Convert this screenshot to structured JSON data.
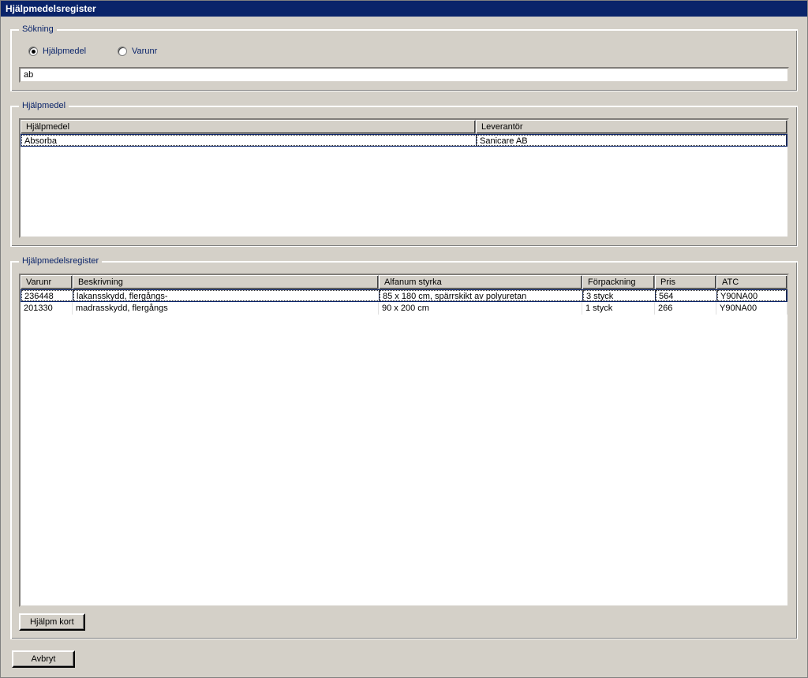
{
  "window": {
    "title": "Hjälpmedelsregister"
  },
  "search": {
    "legend": "Sökning",
    "radio_hjalpmedel": "Hjälpmedel",
    "radio_varunr": "Varunr",
    "input_value": "ab"
  },
  "hlist": {
    "legend": "Hjälpmedel",
    "headers": {
      "col1": "Hjälpmedel",
      "col2": "Leverantör"
    },
    "rows": [
      {
        "col1": "Absorba",
        "col2": "Sanicare AB"
      }
    ]
  },
  "register": {
    "legend": "Hjälpmedelsregister",
    "headers": {
      "col1": "Varunr",
      "col2": "Beskrivning",
      "col3": "Alfanum styrka",
      "col4": "Förpackning",
      "col5": "Pris",
      "col6": "ATC"
    },
    "rows": [
      {
        "col1": "236448",
        "col2": "lakansskydd, flergångs-",
        "col3": "85 x 180 cm, spärrskikt av polyuretan",
        "col4": "3 styck",
        "col5": "564",
        "col6": "Y90NA00"
      },
      {
        "col1": "201330",
        "col2": "madrasskydd, flergångs",
        "col3": "90 x 200 cm",
        "col4": "1 styck",
        "col5": "266",
        "col6": "Y90NA00"
      }
    ]
  },
  "buttons": {
    "hjalpm_kort": "Hjälpm kort",
    "avbryt": "Avbryt"
  }
}
